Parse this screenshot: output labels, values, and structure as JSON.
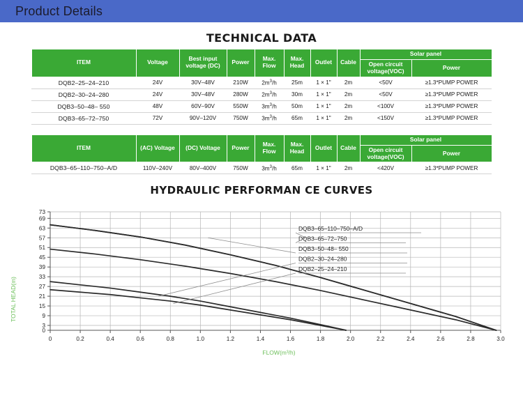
{
  "header": {
    "title": "Product Details",
    "bar_color": "#4a69c8"
  },
  "tech_section": {
    "title": "TECHNICAL DATA",
    "accent_color": "#3aa935"
  },
  "table1": {
    "group_header": "Solar panel",
    "headers": [
      "ITEM",
      "Voltage",
      "Best input voltage (DC)",
      "Power",
      "Max. Flow",
      "Max. Head",
      "Outlet",
      "Cable",
      "Open circuit voltage(VOC)",
      "Power"
    ],
    "rows": [
      {
        "item": "DQB2–25–24–210",
        "voltage": "24V",
        "best_input": "30V–48V",
        "power": "210W",
        "max_flow": "2m³/h",
        "max_head": "25m",
        "outlet": "1 × 1\"",
        "cable": "2m",
        "voc": "<50V",
        "panel_power": "≥1.3*PUMP POWER"
      },
      {
        "item": "DQB2–30–24–280",
        "voltage": "24V",
        "best_input": "30V–48V",
        "power": "280W",
        "max_flow": "2m³/h",
        "max_head": "30m",
        "outlet": "1 × 1\"",
        "cable": "2m",
        "voc": "<50V",
        "panel_power": "≥1.3*PUMP POWER"
      },
      {
        "item": "DQB3–50–48– 550",
        "voltage": "48V",
        "best_input": "60V–90V",
        "power": "550W",
        "max_flow": "3m³/h",
        "max_head": "50m",
        "outlet": "1 × 1\"",
        "cable": "2m",
        "voc": "<100V",
        "panel_power": "≥1.3*PUMP POWER"
      },
      {
        "item": "DQB3–65–72–750",
        "voltage": "72V",
        "best_input": "90V–120V",
        "power": "750W",
        "max_flow": "3m³/h",
        "max_head": "65m",
        "outlet": "1 × 1\"",
        "cable": "2m",
        "voc": "<150V",
        "panel_power": "≥1.3*PUMP POWER"
      }
    ]
  },
  "table2": {
    "group_header": "Solar panel",
    "headers": [
      "ITEM",
      "(AC) Voltage",
      "(DC) Voltage",
      "Power",
      "Max. Flow",
      "Max. Head",
      "Outlet",
      "Cable",
      "Open circuit voltage(VOC)",
      "Power"
    ],
    "rows": [
      {
        "item": "DQB3–65–110–750–A/D",
        "ac_voltage": "110V–240V",
        "dc_voltage": "80V–400V",
        "power": "750W",
        "max_flow": "3m³/h",
        "max_head": "65m",
        "outlet": "1 × 1\"",
        "cable": "2m",
        "voc": "<420V",
        "panel_power": "≥1.3*PUMP POWER"
      }
    ]
  },
  "chart_data": {
    "type": "line",
    "title": "HYDRAULIC PERFORMAN CE CURVES",
    "xlabel": "FLOW(m³/h)",
    "ylabel": "TOTAL HEAD(m)",
    "xlim": [
      0,
      3.0
    ],
    "ylim": [
      0,
      73
    ],
    "xticks": [
      0,
      0.2,
      0.4,
      0.6,
      0.8,
      1.0,
      1.2,
      1.4,
      1.6,
      1.8,
      2.0,
      2.2,
      2.4,
      2.6,
      2.8,
      3.0
    ],
    "xtick_labels": [
      "0",
      "0.2",
      "0.4",
      "0.6",
      "0.8",
      "1.0",
      "1.2",
      "1.4",
      "1.6",
      "1.8",
      "2.0",
      "2.2",
      "2.4",
      "2.6",
      "2.8",
      "3.0"
    ],
    "yticks": [
      0,
      3,
      9,
      15,
      21,
      27,
      33,
      39,
      45,
      51,
      57,
      63,
      69,
      73
    ],
    "ytick_labels": [
      "0",
      "3",
      "9",
      "15",
      "21",
      "27",
      "33",
      "39",
      "45",
      "51",
      "57",
      "63",
      "69",
      "73"
    ],
    "grid": true,
    "legend_position": "inside-right",
    "axis_label_color": "#6cbf5a",
    "curve_color": "#2b2b2b",
    "series": [
      {
        "name": "DQB3–65–110–750–A/D",
        "x": [
          0,
          0.3,
          0.6,
          0.9,
          1.2,
          1.5,
          1.8,
          2.1,
          2.4,
          2.7,
          2.97
        ],
        "y": [
          65,
          61.5,
          57.5,
          52.5,
          46.5,
          40,
          32.5,
          24.5,
          16.5,
          8.5,
          0
        ]
      },
      {
        "name": "DQB3–65–72–750",
        "x": [
          0,
          0.3,
          0.6,
          0.9,
          1.2,
          1.5,
          1.8,
          2.1,
          2.4,
          2.7,
          2.97
        ],
        "y": [
          65,
          61.5,
          57.5,
          52.5,
          46.5,
          40,
          32.5,
          24.5,
          16.5,
          8.5,
          0
        ]
      },
      {
        "name": "DQB3–50–48– 550",
        "x": [
          0,
          0.3,
          0.6,
          0.9,
          1.2,
          1.5,
          1.8,
          2.1,
          2.4,
          2.7,
          2.97
        ],
        "y": [
          50,
          47,
          43.5,
          39.5,
          35,
          30,
          24.5,
          18.5,
          12.5,
          6.5,
          0
        ]
      },
      {
        "name": "DQB2–30–24–280",
        "x": [
          0,
          0.2,
          0.4,
          0.6,
          0.8,
          1.0,
          1.2,
          1.4,
          1.6,
          1.8,
          1.97
        ],
        "y": [
          30,
          28,
          26,
          23.5,
          21,
          18,
          14.5,
          11,
          7.5,
          3.5,
          0
        ]
      },
      {
        "name": "DQB2–25–24–210",
        "x": [
          0,
          0.2,
          0.4,
          0.6,
          0.8,
          1.0,
          1.2,
          1.4,
          1.6,
          1.8,
          1.97
        ],
        "y": [
          25,
          23.5,
          22,
          20,
          18,
          15.5,
          12.5,
          9.5,
          6.5,
          3,
          0
        ]
      }
    ],
    "legend_entries": [
      "DQB3–65–110–750–A/D",
      "DQB3–65–72–750",
      "DQB3–50–48– 550",
      "DQB2–30–24–280",
      "DQB2–25–24–210"
    ]
  }
}
